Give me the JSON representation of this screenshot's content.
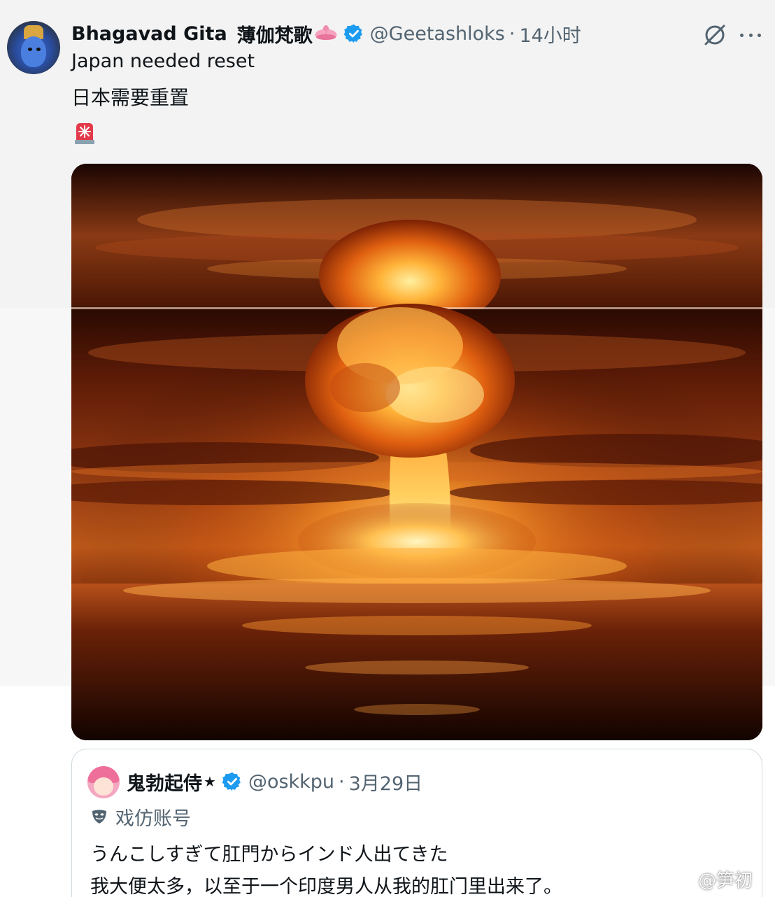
{
  "post": {
    "author_name": "Bhagavad Gita",
    "author_name_cn": "薄伽梵歌",
    "lotus_icon": "lotus-emoji-icon",
    "handle": "@Geetashloks",
    "separator": "·",
    "time": "14小时",
    "text_line_1": "Japan needed reset",
    "text_line_2": "日本需要重置",
    "emoji": "rotating-light-icon",
    "media_subject": "nuclear-mushroom-cloud-image",
    "verified_color": "#1d9bf0"
  },
  "quote": {
    "author_name": "鬼勃起侍",
    "star": "★",
    "handle": "@oskkpu",
    "separator": "·",
    "date": "3月29日",
    "parody_label": "戏仿账号",
    "text_line_1": "うんこしすぎて肛門からインド人出てきた",
    "text_line_2": "我大便太多，以至于一个印度男人从我的肛门里出来了。"
  },
  "watermark": {
    "text": "@笋初",
    "icon": "weibo-icon"
  },
  "icons": {
    "grok": "grok-icon",
    "more": "more-dots-icon"
  }
}
